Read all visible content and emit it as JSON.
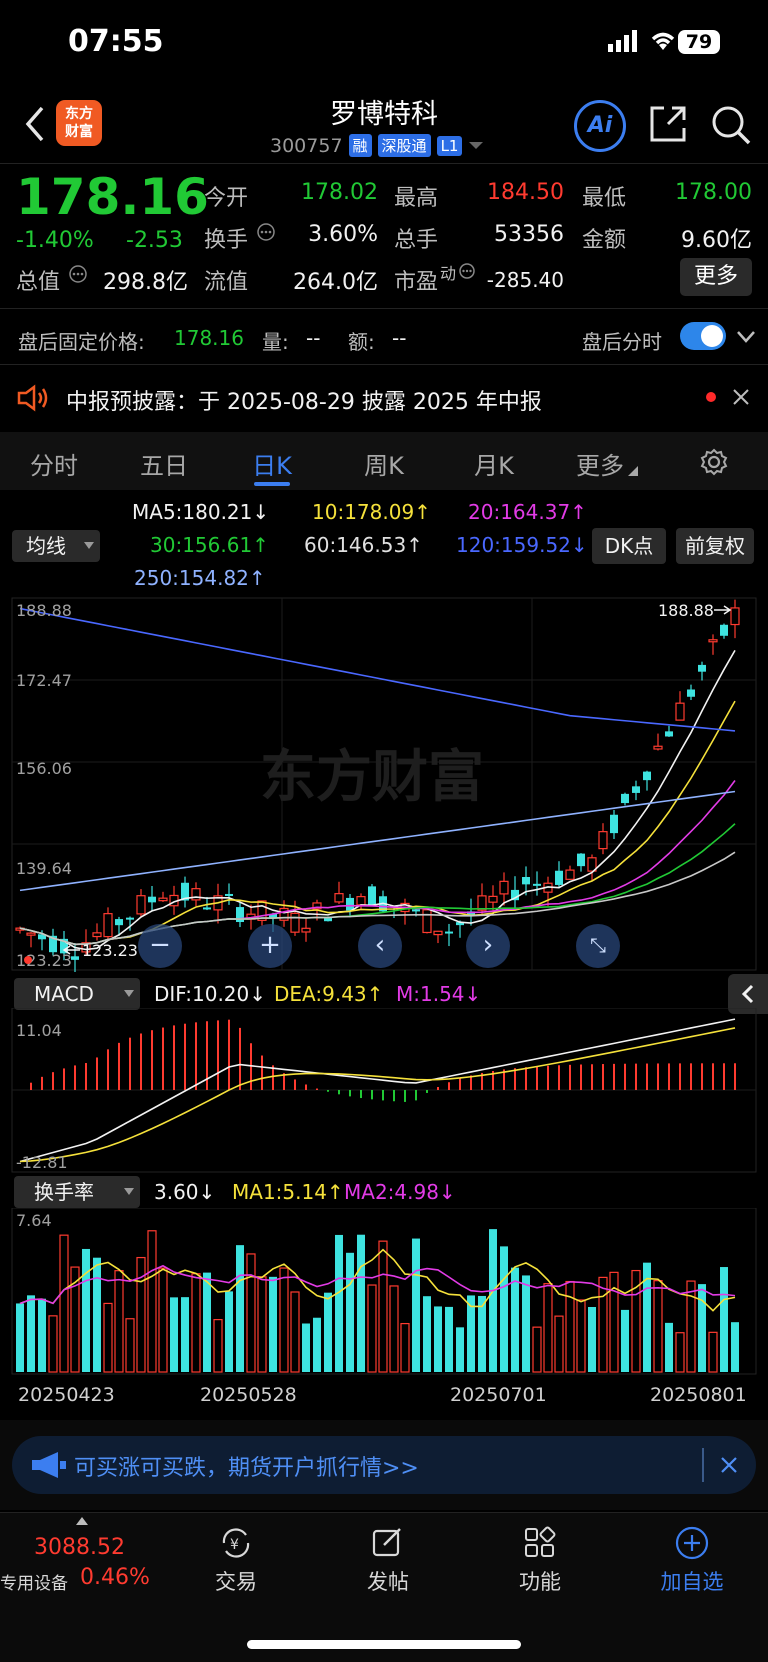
{
  "status": {
    "time": "07:55",
    "battery": "79"
  },
  "header": {
    "logo_text_1": "东方",
    "logo_text_2": "财富",
    "title": "罗博特科",
    "code": "300757",
    "tags": [
      "融",
      "深股通",
      "L1"
    ],
    "ai_label": "Ai"
  },
  "quote": {
    "price": "178.16",
    "pct": "-1.40%",
    "change": "-2.53",
    "open_label": "今开",
    "open": "178.02",
    "high_label": "最高",
    "high": "184.50",
    "low_label": "最低",
    "low": "178.00",
    "turnover_label": "换手",
    "turnover": "3.60%",
    "volume_label": "总手",
    "volume": "53356",
    "amount_label": "金额",
    "amount": "9.60亿",
    "mktcap_label": "总值",
    "mktcap": "298.8亿",
    "float_label": "流值",
    "float": "264.0亿",
    "pe_label": "市盈",
    "pe_sup": "动",
    "pe": "-285.40",
    "more": "更多"
  },
  "after_hours": {
    "label": "盘后固定价格:",
    "price": "178.16",
    "vol_label": "量:",
    "vol": "--",
    "amt_label": "额:",
    "amt": "--",
    "toggle_label": "盘后分时",
    "toggle_on": true
  },
  "notice": {
    "text": "中报预披露：于 2025-08-29 披露 2025 年中报"
  },
  "tabs": [
    "分时",
    "五日",
    "日K",
    "周K",
    "月K",
    "更多"
  ],
  "active_tab": "日K",
  "ma": {
    "selector": "均线",
    "ma5": "MA5:180.21↓",
    "ma10": "10:178.09↑",
    "ma20": "20:164.37↑",
    "ma30": "30:156.61↑",
    "ma60": "60:146.53↑",
    "ma120": "120:159.52↓",
    "ma250": "250:154.82↑",
    "dk_button": "DK点",
    "adjust_button": "前复权"
  },
  "kchart": {
    "y_labels": [
      "188.88",
      "172.47",
      "156.06",
      "139.64",
      "123.23"
    ],
    "high_marker": "188.88",
    "low_marker": "123.23",
    "watermark": "东方财富",
    "colors": {
      "up": "#ff3b30",
      "down": "#3ee3e0"
    }
  },
  "macd": {
    "selector": "MACD",
    "dif": "DIF:10.20↓",
    "dea": "DEA:9.43↑",
    "m": "M:1.54↓",
    "y_top": "11.04",
    "y_bottom": "-12.81"
  },
  "turnover_panel": {
    "selector": "换手率",
    "value": "3.60↓",
    "ma1": "MA1:5.14↑",
    "ma2": "MA2:4.98↓",
    "y_top": "7.64"
  },
  "dates": [
    "20250423",
    "20250528",
    "20250701",
    "20250801"
  ],
  "banner": {
    "text": "可买涨可买跌，期货开户抓行情>>"
  },
  "bottom_nav": {
    "index_value": "3088.52",
    "index_name": "专用设备",
    "index_pct": "0.46%",
    "items": [
      "交易",
      "发帖",
      "功能",
      "加自选"
    ]
  }
}
